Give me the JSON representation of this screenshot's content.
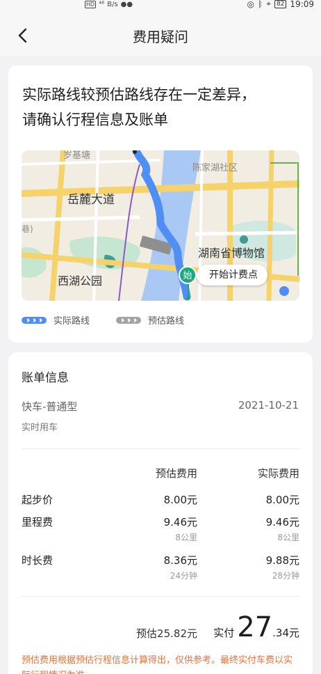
{
  "status_bar": {
    "hd": "HD",
    "signal": "⁴⁶",
    "speed": "B/s",
    "time": "19:09",
    "battery": "82"
  },
  "nav": {
    "title": "费用疑问",
    "back_icon": "chevron-left-icon"
  },
  "route_card": {
    "headline_line1": "实际路线较预估路线存在一定差异，",
    "headline_line2": "请确认行程信息及账单",
    "map": {
      "labels": {
        "top_left": "岁基塘",
        "top_right": "陈家湖社区",
        "road": "岳麓大道",
        "left_edge": "巷)",
        "museum": "湖南省博物馆",
        "park": "西湖公园"
      },
      "start_marker": "始",
      "start_label": "开始计费点"
    },
    "legend": {
      "actual": "实际路线",
      "estimated": "预估路线"
    },
    "colors": {
      "actual_route": "#4f8ef5",
      "estimated_route": "#a4a4a4"
    }
  },
  "bill_card": {
    "title": "账单信息",
    "car_type": "快车-普通型",
    "date": "2021-10-21",
    "ride_mode": "实时用车",
    "columns": {
      "estimated": "预估费用",
      "actual": "实际费用"
    },
    "rows": [
      {
        "label": "起步价",
        "estimated": "8.00元",
        "estimated_sub": "",
        "actual": "8.00元",
        "actual_sub": ""
      },
      {
        "label": "里程费",
        "estimated": "9.46元",
        "estimated_sub": "8公里",
        "actual": "9.46元",
        "actual_sub": "8公里"
      },
      {
        "label": "时长费",
        "estimated": "8.36元",
        "estimated_sub": "24分钟",
        "actual": "9.88元",
        "actual_sub": "28分钟"
      }
    ],
    "estimated_total": "预估25.82元",
    "actual_total": {
      "label": "实付",
      "integer": "27",
      "decimal": ".34元"
    },
    "note": "预估费用根据预估行程信息计算得出，仅供参考。最终实付车费以实际行程情况为准",
    "note_color": "#e8713a"
  }
}
